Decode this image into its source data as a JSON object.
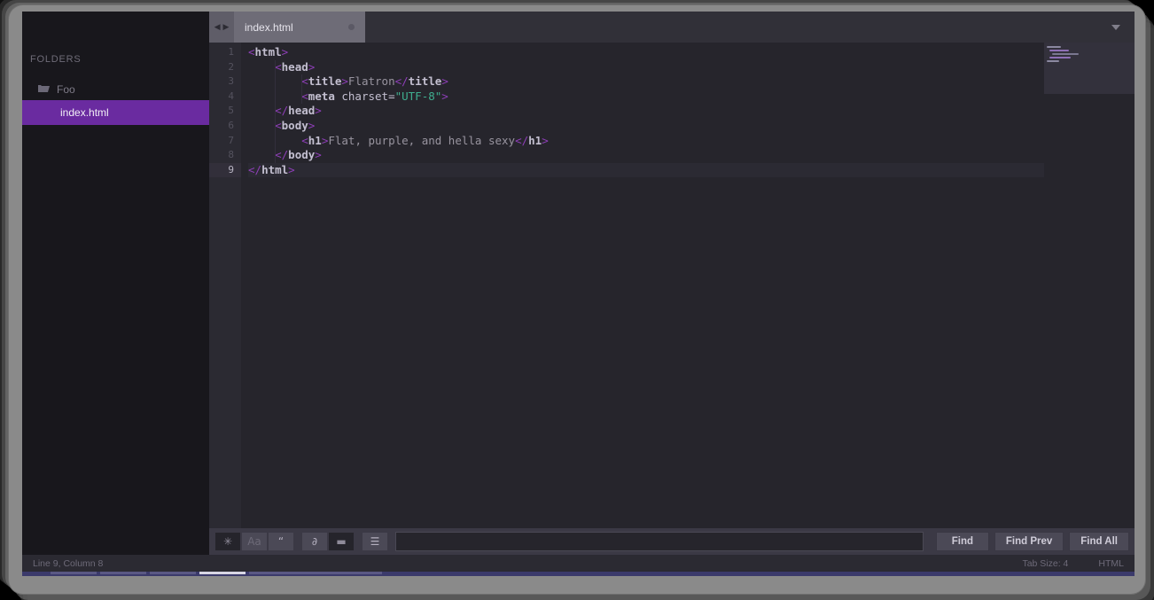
{
  "window": {
    "title": "index.html"
  },
  "sidebar": {
    "heading": "FOLDERS",
    "folder": {
      "name": "Foo",
      "icon": "folder-icon"
    },
    "files": [
      {
        "name": "index.html",
        "selected": true
      }
    ]
  },
  "tabbar": {
    "prev_arrow": "◀",
    "next_arrow": "▶",
    "tabs": [
      {
        "label": "index.html",
        "dirty": true,
        "active": true
      }
    ],
    "menu_icon": "chevron-down-icon"
  },
  "editor": {
    "language": "HTML",
    "tab_size_label": "Tab Size: 4",
    "cursor_label": "Line 9, Column 8",
    "active_line": 9,
    "line_numbers": [
      1,
      2,
      3,
      4,
      5,
      6,
      7,
      8,
      9
    ],
    "lines": [
      {
        "n": 1,
        "indent": 0,
        "tokens": [
          {
            "t": "pun",
            "v": "<"
          },
          {
            "t": "tag",
            "v": "html"
          },
          {
            "t": "pun",
            "v": ">"
          }
        ]
      },
      {
        "n": 2,
        "indent": 1,
        "tokens": [
          {
            "t": "pun",
            "v": "<"
          },
          {
            "t": "tag",
            "v": "head"
          },
          {
            "t": "pun",
            "v": ">"
          }
        ]
      },
      {
        "n": 3,
        "indent": 2,
        "tokens": [
          {
            "t": "pun",
            "v": "<"
          },
          {
            "t": "tag",
            "v": "title"
          },
          {
            "t": "pun",
            "v": ">"
          },
          {
            "t": "txt",
            "v": "Flatron"
          },
          {
            "t": "pun",
            "v": "</"
          },
          {
            "t": "tag",
            "v": "title"
          },
          {
            "t": "pun",
            "v": ">"
          }
        ]
      },
      {
        "n": 4,
        "indent": 2,
        "tokens": [
          {
            "t": "pun",
            "v": "<"
          },
          {
            "t": "tag",
            "v": "meta"
          },
          {
            "t": "attr",
            "v": " charset="
          },
          {
            "t": "str",
            "v": "\"UTF-8\""
          },
          {
            "t": "pun",
            "v": ">"
          }
        ]
      },
      {
        "n": 5,
        "indent": 1,
        "tokens": [
          {
            "t": "pun",
            "v": "</"
          },
          {
            "t": "tag",
            "v": "head"
          },
          {
            "t": "pun",
            "v": ">"
          }
        ]
      },
      {
        "n": 6,
        "indent": 1,
        "tokens": [
          {
            "t": "pun",
            "v": "<"
          },
          {
            "t": "tag",
            "v": "body"
          },
          {
            "t": "pun",
            "v": ">"
          }
        ]
      },
      {
        "n": 7,
        "indent": 2,
        "tokens": [
          {
            "t": "pun",
            "v": "<"
          },
          {
            "t": "tag",
            "v": "h1"
          },
          {
            "t": "pun",
            "v": ">"
          },
          {
            "t": "txt",
            "v": "Flat, purple, and hella sexy"
          },
          {
            "t": "pun",
            "v": "</"
          },
          {
            "t": "tag",
            "v": "h1"
          },
          {
            "t": "pun",
            "v": ">"
          }
        ]
      },
      {
        "n": 8,
        "indent": 1,
        "tokens": [
          {
            "t": "pun",
            "v": "</"
          },
          {
            "t": "tag",
            "v": "body"
          },
          {
            "t": "pun",
            "v": ">"
          }
        ]
      },
      {
        "n": 9,
        "indent": 0,
        "tokens": [
          {
            "t": "pun",
            "v": "</"
          },
          {
            "t": "tag",
            "v": "html"
          },
          {
            "t": "pun",
            "v": ">"
          }
        ]
      }
    ]
  },
  "findbar": {
    "toggles": [
      {
        "name": "regex-toggle",
        "glyph": "✳",
        "pressed": true,
        "dim": false
      },
      {
        "name": "case-sensitive-toggle",
        "glyph": "Aa",
        "pressed": false,
        "dim": true
      },
      {
        "name": "whole-word-toggle",
        "glyph": "“",
        "pressed": false,
        "dim": false
      },
      {
        "name": "wrap-toggle",
        "glyph": "∂",
        "pressed": false,
        "dim": false
      },
      {
        "name": "in-selection-toggle",
        "glyph": "▬",
        "pressed": true,
        "dim": false
      },
      {
        "name": "highlight-toggle",
        "glyph": "☰",
        "pressed": false,
        "dim": false
      }
    ],
    "input_value": "",
    "input_placeholder": "",
    "buttons": [
      {
        "name": "find-button",
        "label": "Find"
      },
      {
        "name": "find-prev-button",
        "label": "Find Prev"
      },
      {
        "name": "find-all-button",
        "label": "Find All"
      }
    ]
  },
  "colors": {
    "accent_purple": "#6a2ba0",
    "editor_bg": "#26252c",
    "sidebar_bg": "#18171c",
    "tag": "#8e3fb8",
    "string": "#3fae8f"
  }
}
